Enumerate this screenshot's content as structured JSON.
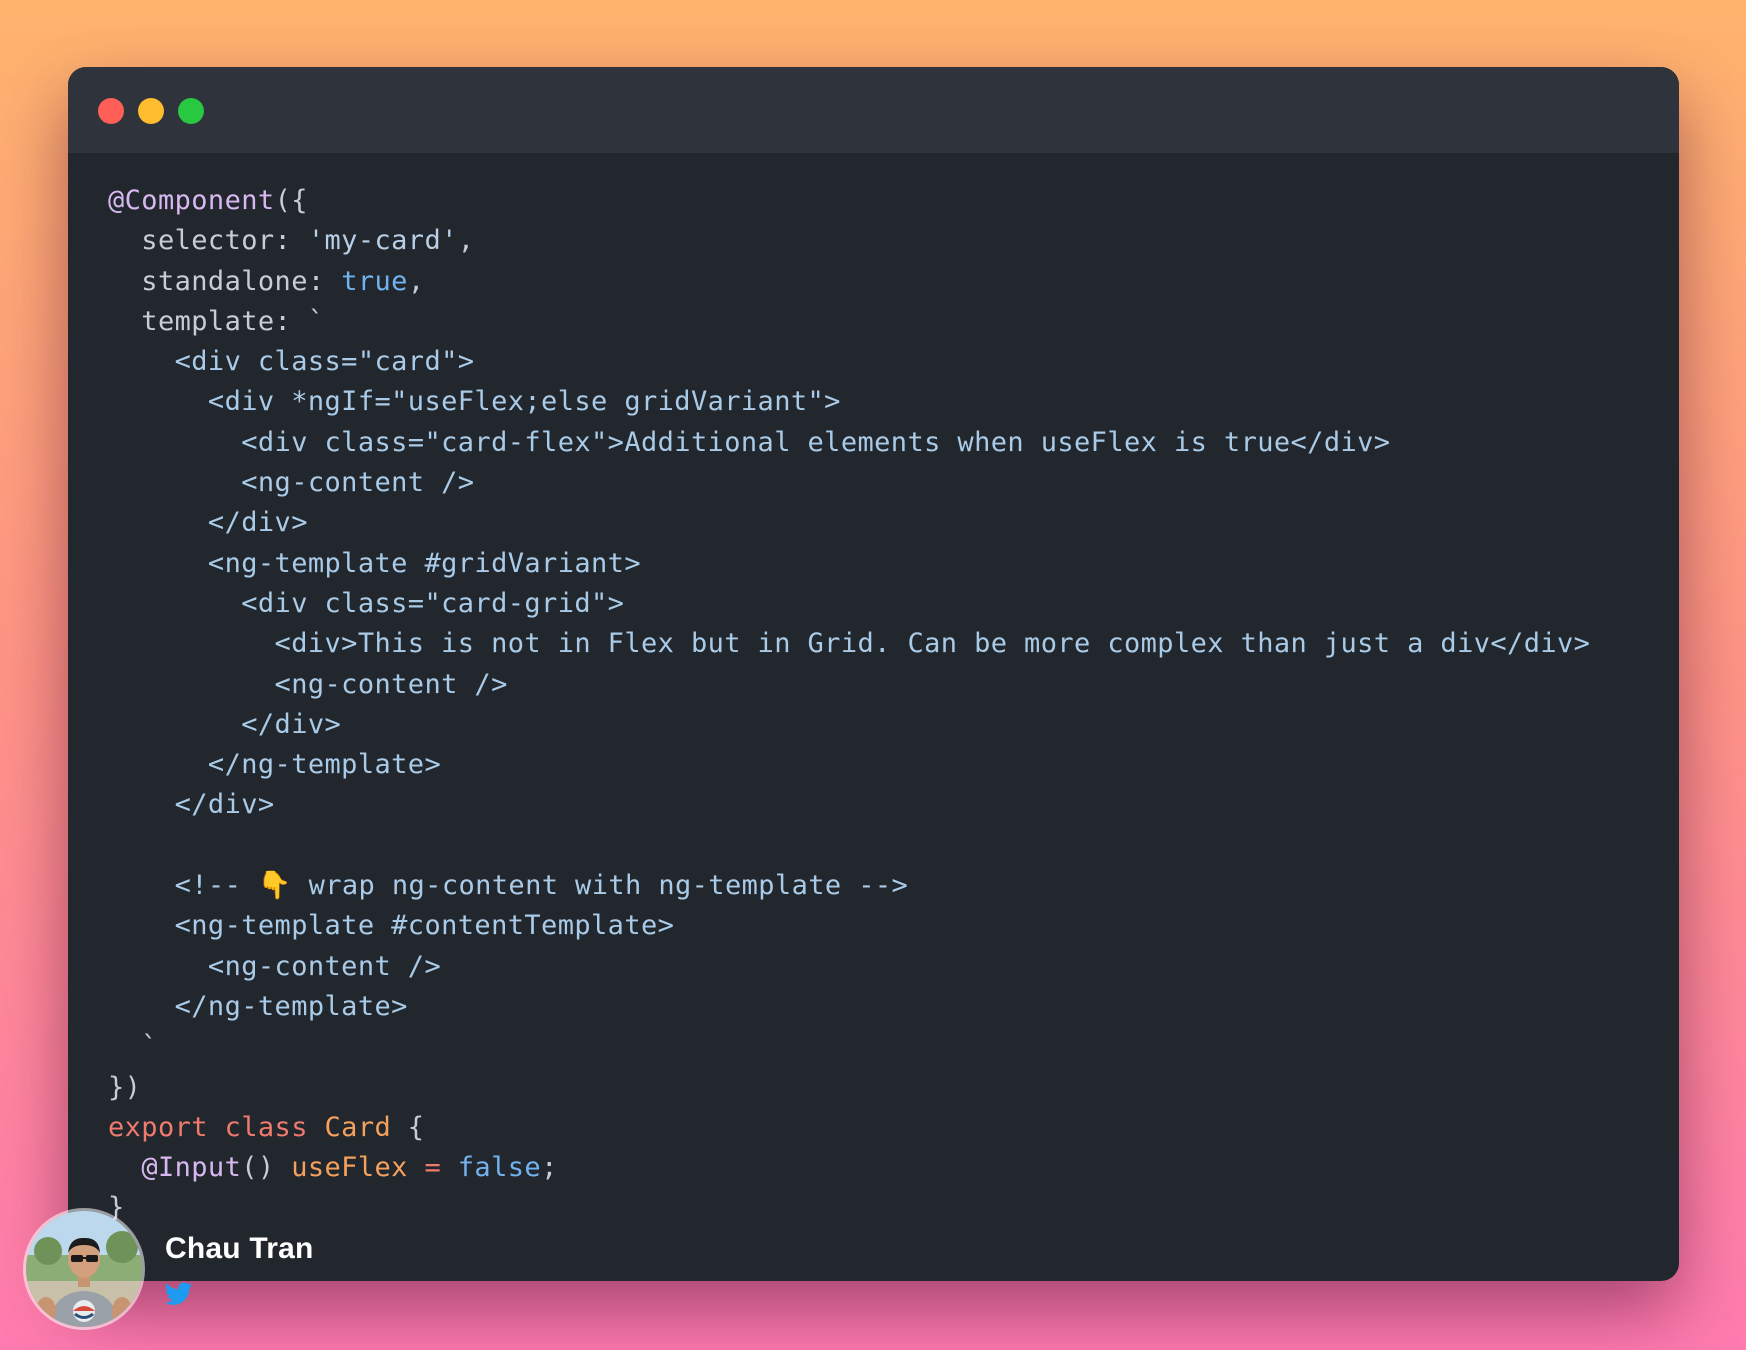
{
  "colors": {
    "window_bg": "#22262d",
    "titlebar_bg": "#2f333b",
    "close": "#ff5f57",
    "minimize": "#febc2e",
    "maximize": "#28c840",
    "twitter": "#1d9bf0"
  },
  "window_controls": [
    "close",
    "minimize",
    "maximize"
  ],
  "code_lines": [
    [
      {
        "t": "dec",
        "v": "@Component"
      },
      {
        "t": "plain",
        "v": "({"
      }
    ],
    [
      {
        "t": "plain",
        "v": "  selector: "
      },
      {
        "t": "str",
        "v": "'my-card'"
      },
      {
        "t": "plain",
        "v": ","
      }
    ],
    [
      {
        "t": "plain",
        "v": "  standalone: "
      },
      {
        "t": "bool",
        "v": "true"
      },
      {
        "t": "plain",
        "v": ","
      }
    ],
    [
      {
        "t": "plain",
        "v": "  template: `"
      }
    ],
    [
      {
        "t": "tpl",
        "v": "    <div class=\"card\">"
      }
    ],
    [
      {
        "t": "tpl",
        "v": "      <div *ngIf=\"useFlex;else gridVariant\">"
      }
    ],
    [
      {
        "t": "tpl",
        "v": "        <div class=\"card-flex\">Additional elements when useFlex is true</div>"
      }
    ],
    [
      {
        "t": "tpl",
        "v": "        <ng-content />"
      }
    ],
    [
      {
        "t": "tpl",
        "v": "      </div>"
      }
    ],
    [
      {
        "t": "tpl",
        "v": "      <ng-template #gridVariant>"
      }
    ],
    [
      {
        "t": "tpl",
        "v": "        <div class=\"card-grid\">"
      }
    ],
    [
      {
        "t": "tpl",
        "v": "          <div>This is not in Flex but in Grid. Can be more complex than just a div</div>"
      }
    ],
    [
      {
        "t": "tpl",
        "v": "          <ng-content />"
      }
    ],
    [
      {
        "t": "tpl",
        "v": "        </div>"
      }
    ],
    [
      {
        "t": "tpl",
        "v": "      </ng-template>"
      }
    ],
    [
      {
        "t": "tpl",
        "v": "    </div>"
      }
    ],
    [
      {
        "t": "tpl",
        "v": ""
      }
    ],
    [
      {
        "t": "tpl",
        "v": "    <!-- 👇 wrap ng-content with ng-template -->"
      }
    ],
    [
      {
        "t": "tpl",
        "v": "    <ng-template #contentTemplate>"
      }
    ],
    [
      {
        "t": "tpl",
        "v": "      <ng-content />"
      }
    ],
    [
      {
        "t": "tpl",
        "v": "    </ng-template>"
      }
    ],
    [
      {
        "t": "plain",
        "v": "  `"
      }
    ],
    [
      {
        "t": "plain",
        "v": "})"
      }
    ],
    [
      {
        "t": "kw",
        "v": "export class "
      },
      {
        "t": "type",
        "v": "Card"
      },
      {
        "t": "plain",
        "v": " {"
      }
    ],
    [
      {
        "t": "plain",
        "v": "  "
      },
      {
        "t": "dec",
        "v": "@Input"
      },
      {
        "t": "plain",
        "v": "() "
      },
      {
        "t": "prop",
        "v": "useFlex"
      },
      {
        "t": "op",
        "v": " = "
      },
      {
        "t": "bool",
        "v": "false"
      },
      {
        "t": "plain",
        "v": ";"
      }
    ],
    [
      {
        "t": "plain",
        "v": "}"
      }
    ]
  ],
  "author": {
    "name": "Chau Tran",
    "social_icon": "twitter-icon",
    "avatar_icon": "avatar-photo"
  }
}
